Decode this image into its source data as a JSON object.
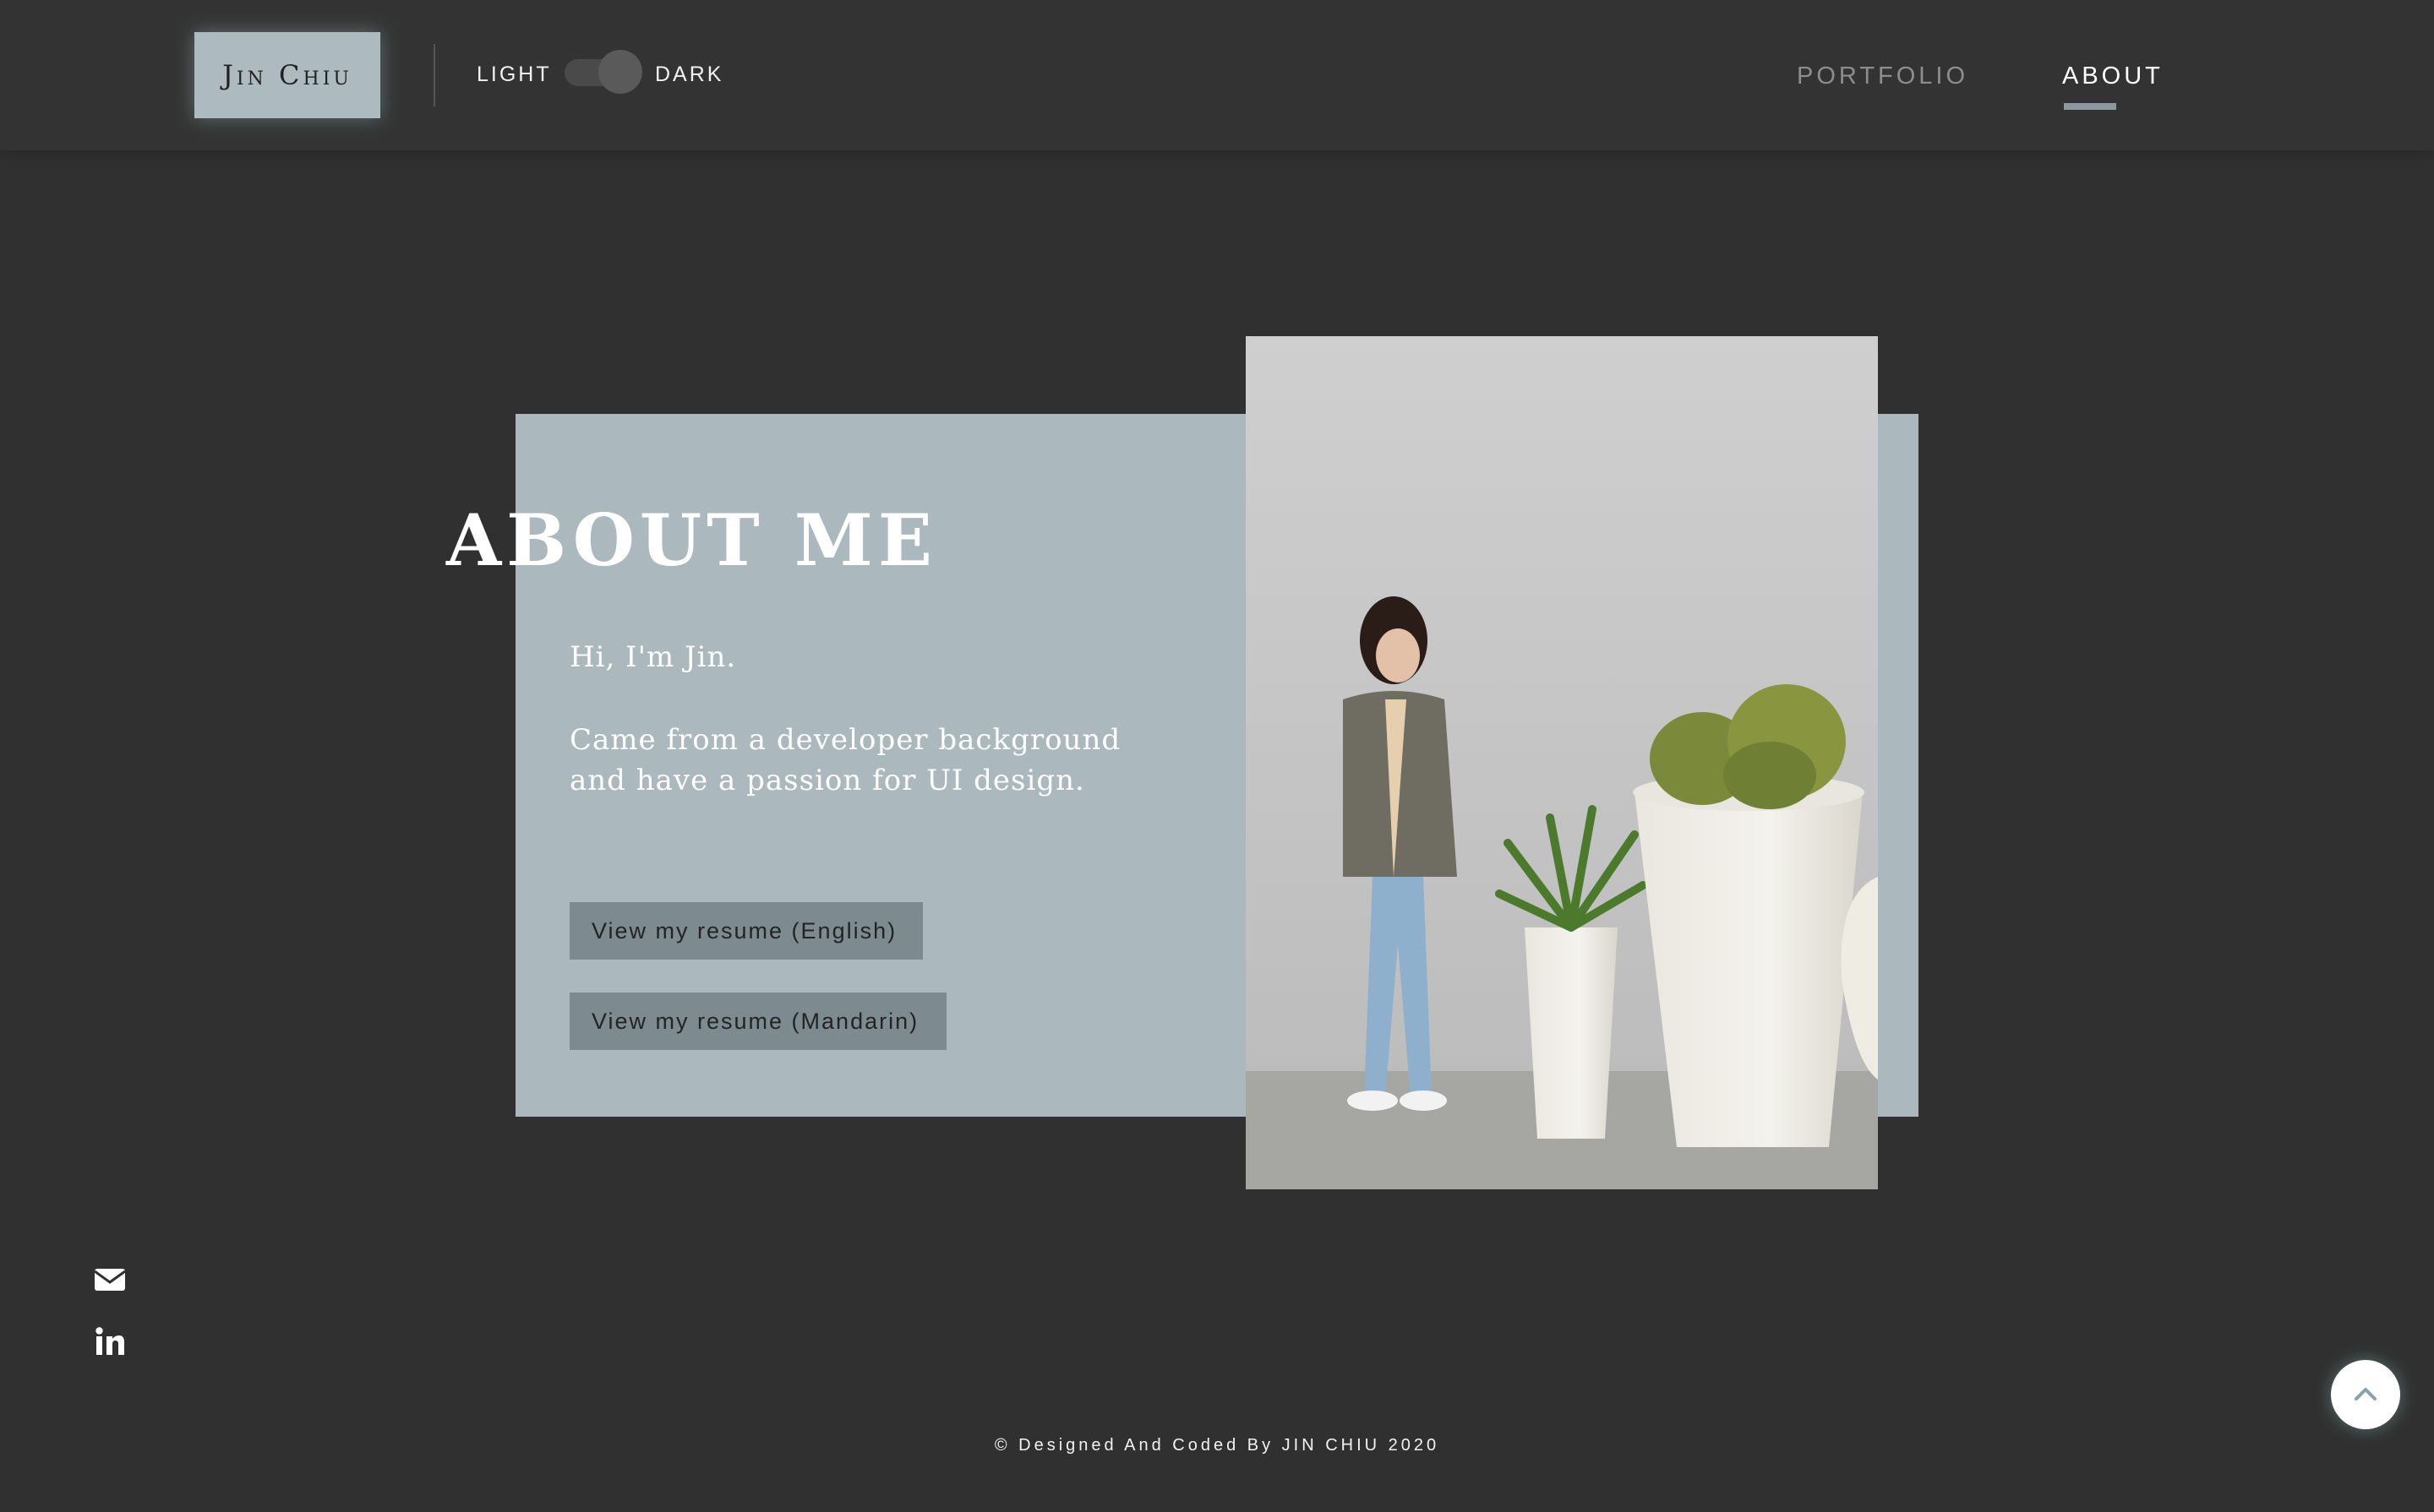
{
  "header": {
    "logo": "Jin Chiu",
    "theme_light": "LIGHT",
    "theme_dark": "DARK",
    "nav": {
      "portfolio": "PORTFOLIO",
      "about": "ABOUT"
    }
  },
  "about": {
    "title": "ABOUT ME",
    "greeting": "Hi, I'm Jin.",
    "bio": "Came from a developer background and have a passion for UI design.",
    "resume_english": "View my resume (English)",
    "resume_mandarin": "View my resume (Mandarin)"
  },
  "footer": {
    "text": "© Designed And Coded By JIN CHIU 2020"
  },
  "icons": {
    "mail": "envelope-icon",
    "linkedin": "linkedin-icon",
    "scroll_top": "chevron-up-icon"
  },
  "colors": {
    "background": "#303030",
    "card": "#abb9bf",
    "button": "#7d8b91",
    "accent_glow": "#9bbfc3"
  }
}
